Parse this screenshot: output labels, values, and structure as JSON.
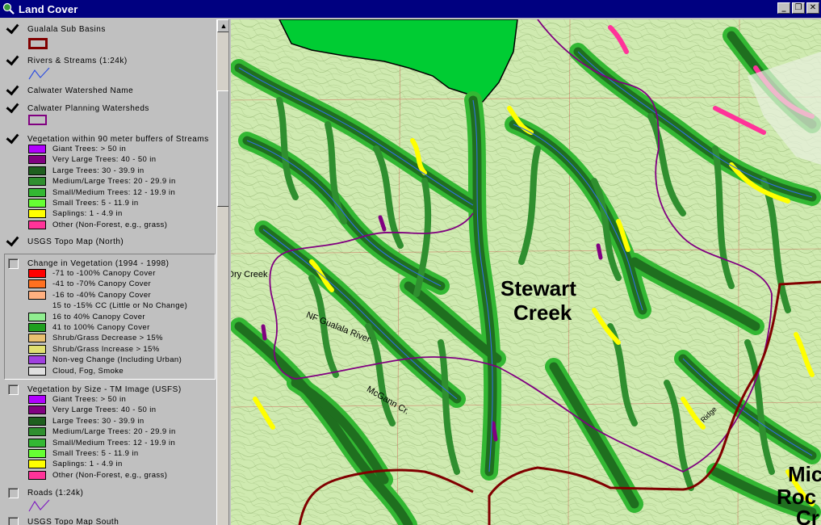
{
  "window": {
    "title": "Land Cover",
    "icon": "magnifier-globe-icon",
    "buttons": {
      "minimize": "_",
      "restore": "❐",
      "close": "✕"
    }
  },
  "legend": {
    "themes": [
      {
        "id": "gualala",
        "name": "Gualala Sub Basins",
        "checked": true,
        "symbol": "polygon-outline",
        "color": "#800000"
      },
      {
        "id": "rivers",
        "name": "Rivers & Streams (1:24k)",
        "checked": true,
        "symbol": "line",
        "color": "#3050e0"
      },
      {
        "id": "calwater-name",
        "name": "Calwater Watershed Name",
        "checked": true
      },
      {
        "id": "calwater-planning",
        "name": "Calwater Planning Watersheds",
        "checked": true,
        "symbol": "polygon-outline",
        "color": "#800080"
      },
      {
        "id": "veg90",
        "name": "Vegetation within 90 meter buffers of Streams",
        "checked": true,
        "classes": [
          {
            "label": "Giant Trees: > 50 in",
            "color": "#b000ff"
          },
          {
            "label": "Very Large Trees: 40 - 50 in",
            "color": "#800080"
          },
          {
            "label": "Large Trees: 30 - 39.9 in",
            "color": "#1f5f1f"
          },
          {
            "label": "Medium/Large Trees: 20 - 29.9 in",
            "color": "#2f8f2f"
          },
          {
            "label": "Small/Medium Trees: 12 - 19.9 in",
            "color": "#33b833"
          },
          {
            "label": "Small Trees: 5 - 11.9 in",
            "color": "#66ff33"
          },
          {
            "label": "Saplings: 1 - 4.9 in",
            "color": "#ffff00"
          },
          {
            "label": "Other (Non-Forest, e.g., grass)",
            "color": "#ff3399"
          }
        ]
      },
      {
        "id": "usgs-north",
        "name": "USGS Topo Map (North)",
        "checked": true
      },
      {
        "id": "change",
        "name": "Change in Vegetation (1994 - 1998)",
        "checked": false,
        "classes": [
          {
            "label": "-71 to -100% Canopy Cover",
            "color": "#ff0000"
          },
          {
            "label": "-41 to -70% Canopy Cover",
            "color": "#ff7020"
          },
          {
            "label": "-16 to -40% Canopy Cover",
            "color": "#ffb080"
          },
          {
            "label": "15 to -15% CC (Little or No Change)",
            "color": ""
          },
          {
            "label": "16 to 40% Canopy Cover",
            "color": "#90ee90"
          },
          {
            "label": "41 to 100% Canopy Cover",
            "color": "#1f9f1f"
          },
          {
            "label": "Shrub/Grass Decrease > 15%",
            "color": "#e8c070"
          },
          {
            "label": "Shrub/Grass Increase > 15%",
            "color": "#e0e070"
          },
          {
            "label": "Non-veg Change (Including Urban)",
            "color": "#a040e0"
          },
          {
            "label": "Cloud, Fog, Smoke",
            "color": "#e0e0e0"
          }
        ]
      },
      {
        "id": "veg-size",
        "name": "Vegetation by Size - TM Image (USFS)",
        "checked": false,
        "classes": [
          {
            "label": "Giant Trees: > 50 in",
            "color": "#b000ff"
          },
          {
            "label": "Very Large Trees: 40 - 50 in",
            "color": "#800080"
          },
          {
            "label": "Large Trees: 30 - 39.9 in",
            "color": "#1f5f1f"
          },
          {
            "label": "Medium/Large Trees: 20 - 29.9 in",
            "color": "#2f8f2f"
          },
          {
            "label": "Small/Medium Trees: 12 - 19.9 in",
            "color": "#33b833"
          },
          {
            "label": "Small Trees: 5 - 11.9 in",
            "color": "#66ff33"
          },
          {
            "label": "Saplings: 1 - 4.9 in",
            "color": "#ffff00"
          },
          {
            "label": "Other (Non-Forest, e.g., grass)",
            "color": "#ff3399"
          }
        ]
      },
      {
        "id": "roads",
        "name": "Roads (1:24k)",
        "checked": false,
        "symbol": "line",
        "color": "#8020c0"
      },
      {
        "id": "usgs-south",
        "name": "USGS Topo Map South",
        "checked": false
      }
    ]
  },
  "map": {
    "labels": {
      "watershed_1": "Stewart",
      "watershed_2": "Creek",
      "watershed_3a": "Mic",
      "watershed_3b": "Roc",
      "watershed_3c": "Cr",
      "stream_dry": "Dry Creek",
      "stream_nf": "NF Gualala River",
      "stream_mcgann": "McGann Cr.",
      "road_ridge": "Ridge"
    },
    "colors": {
      "background": "#cfeab0",
      "basin_boundary": "#800000",
      "planning_boundary": "#800080",
      "stream": "#3070e0",
      "large_trees": "#1f6f1f",
      "medium_trees": "#2f9f2f",
      "saplings": "#ffff00",
      "other": "#ff3399",
      "green_fill": "#00cc33"
    }
  }
}
